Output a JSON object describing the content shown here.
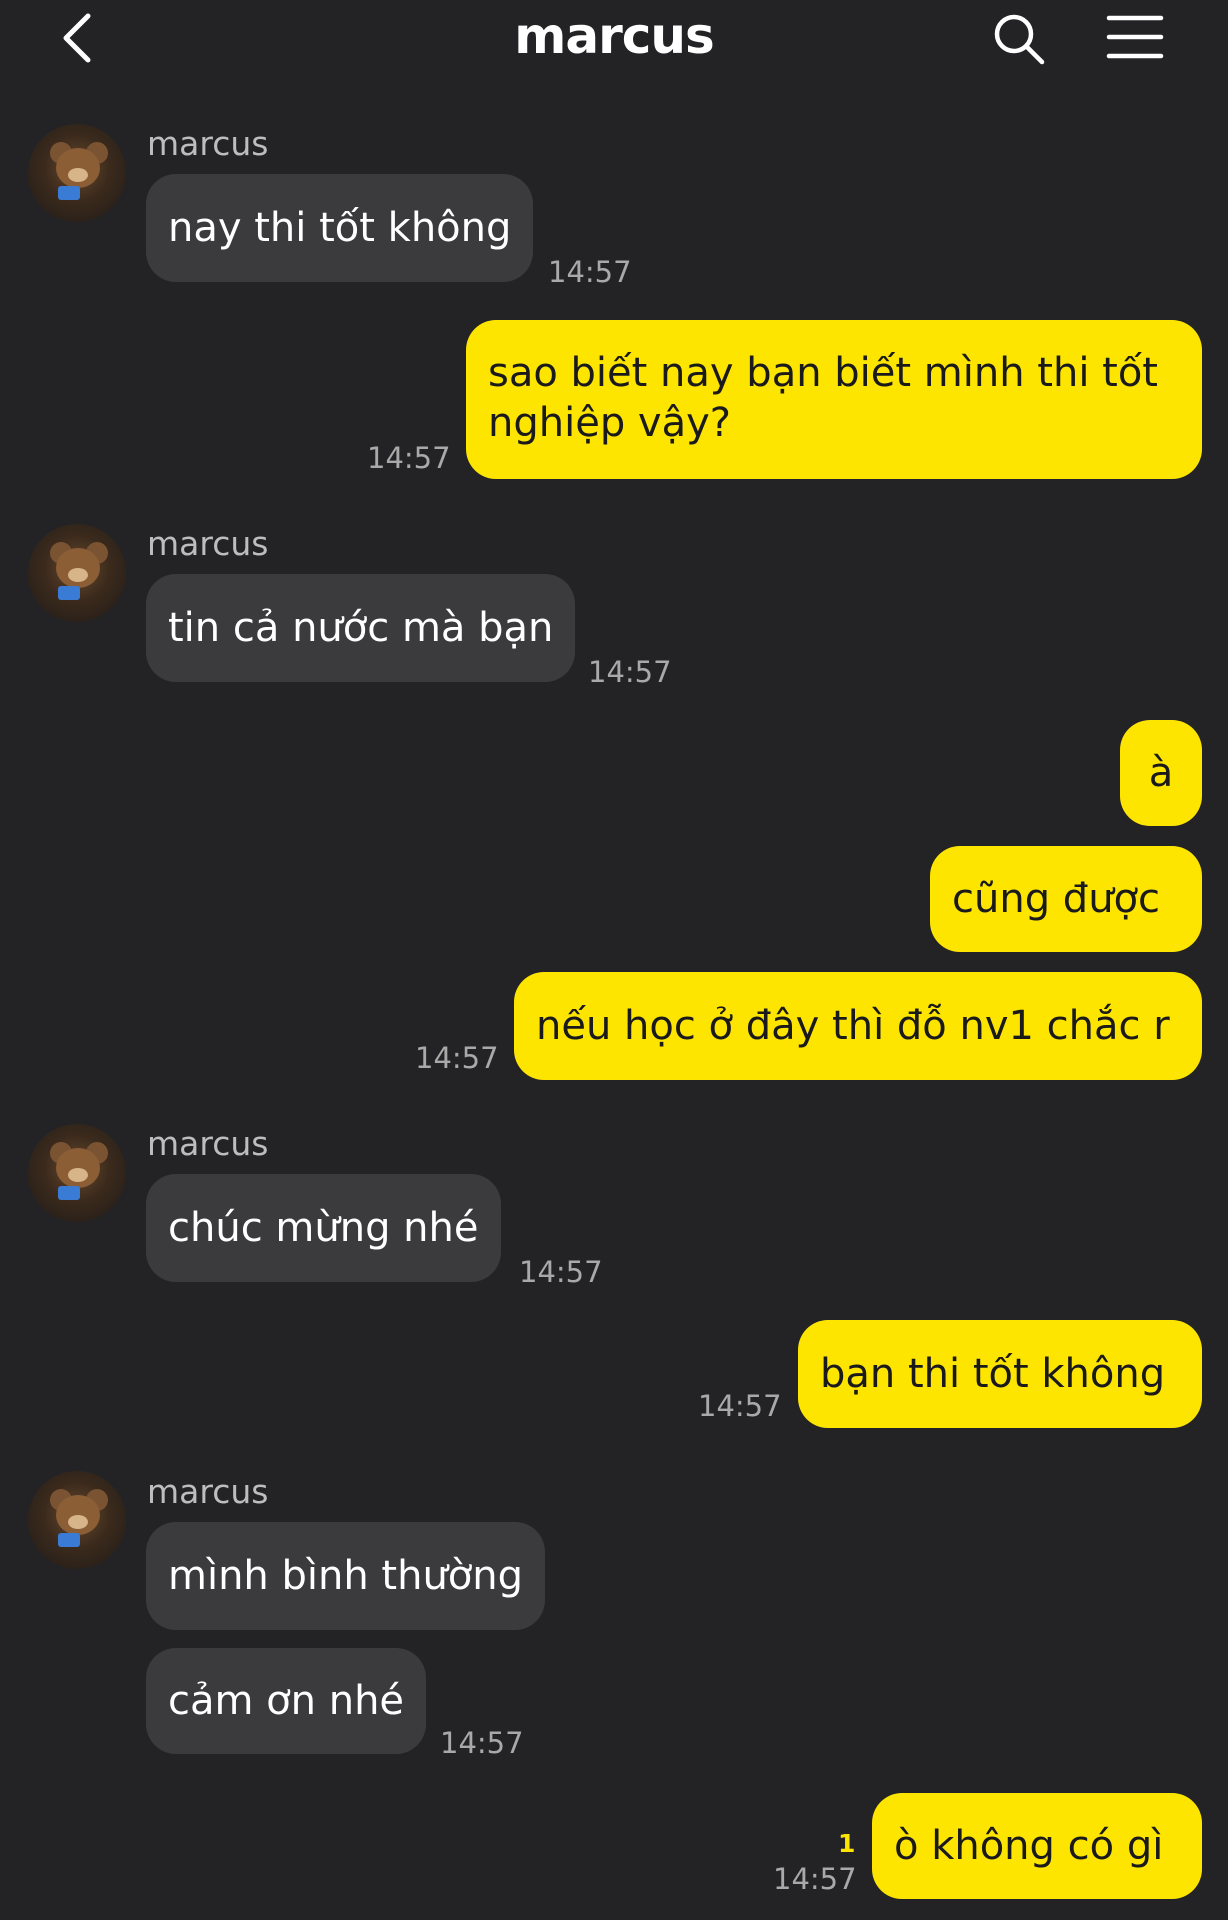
{
  "header": {
    "title": "marcus",
    "back_icon": "back-chevron-icon",
    "search_icon": "search-icon",
    "menu_icon": "menu-icon"
  },
  "colors": {
    "background": "#232325",
    "incoming_bubble": "#3b3b3e",
    "outgoing_bubble": "#fee500",
    "timestamp": "#a9a9a9"
  },
  "messages": [
    {
      "sender": "marcus",
      "text": "nay thi tốt không",
      "time": "14:57"
    },
    {
      "text": "sao biết nay bạn biết mình thi tốt",
      "text2": "nghiệp vậy?",
      "time": "14:57"
    },
    {
      "sender": "marcus",
      "text": "tin cả nước mà bạn",
      "time": "14:57"
    },
    {
      "text": "à"
    },
    {
      "text": "cũng được"
    },
    {
      "text": "nếu học ở đây thì đỗ nv1 chắc r",
      "time": "14:57"
    },
    {
      "sender": "marcus",
      "text": "chúc mừng nhé",
      "time": "14:57"
    },
    {
      "text": "bạn thi tốt không",
      "time": "14:57"
    },
    {
      "sender": "marcus",
      "text": "mình bình thường"
    },
    {
      "text": "cảm ơn nhé",
      "time": "14:57"
    },
    {
      "text": "ò không có gì",
      "time": "14:57",
      "unread": "1"
    }
  ]
}
